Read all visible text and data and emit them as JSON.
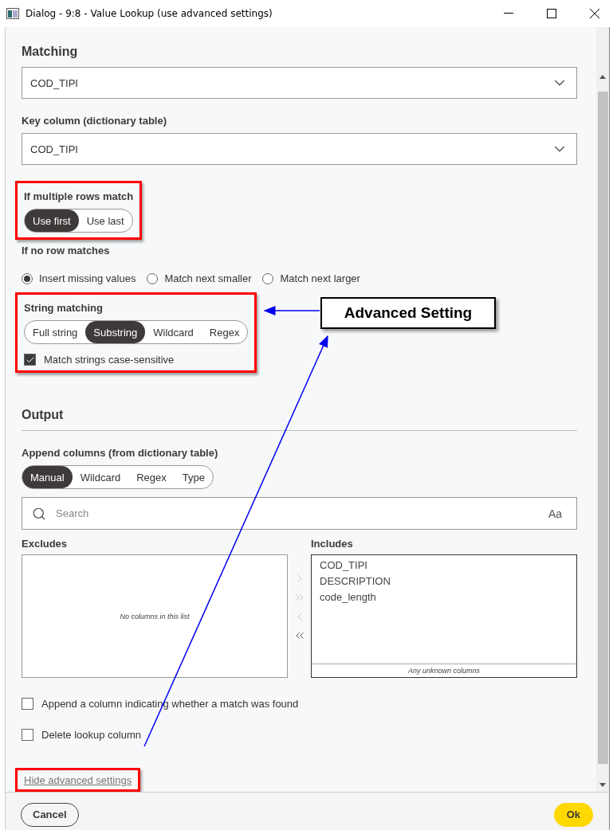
{
  "window": {
    "title": "Dialog - 9:8 - Value Lookup (use advanced settings)"
  },
  "matching": {
    "heading": "Matching",
    "lookup_column": {
      "value": "COD_TIPI"
    },
    "key_column": {
      "label": "Key column (dictionary table)",
      "value": "COD_TIPI"
    }
  },
  "multiple_rows": {
    "label": "If multiple rows match",
    "highlighted": true,
    "options": [
      {
        "label": "Use first",
        "selected": true
      },
      {
        "label": "Use last",
        "selected": false
      }
    ]
  },
  "no_row": {
    "label": "If no row matches",
    "options": [
      {
        "label": "Insert missing values",
        "selected": true
      },
      {
        "label": "Match next smaller",
        "selected": false
      },
      {
        "label": "Match next larger",
        "selected": false
      }
    ]
  },
  "string_matching": {
    "label": "String matching",
    "highlighted": true,
    "options": [
      {
        "label": "Full string",
        "selected": false
      },
      {
        "label": "Substring",
        "selected": true
      },
      {
        "label": "Wildcard",
        "selected": false
      },
      {
        "label": "Regex",
        "selected": false
      }
    ],
    "case_sensitive": {
      "label": "Match strings case-sensitive",
      "checked": true
    }
  },
  "output": {
    "heading": "Output",
    "append_label": "Append columns (from dictionary table)",
    "modes": [
      {
        "label": "Manual",
        "selected": true
      },
      {
        "label": "Wildcard",
        "selected": false
      },
      {
        "label": "Regex",
        "selected": false
      },
      {
        "label": "Type",
        "selected": false
      }
    ],
    "search": {
      "placeholder": "Search",
      "case_toggle": "Aa"
    },
    "excludes": {
      "label": "Excludes",
      "empty_text": "No columns in this list"
    },
    "transfer_buttons": [
      {
        "kind": "add",
        "disabled": true
      },
      {
        "kind": "add_all",
        "disabled": true
      },
      {
        "kind": "remove",
        "disabled": true
      },
      {
        "kind": "remove_all",
        "disabled": false
      }
    ],
    "includes": {
      "label": "Includes",
      "items": [
        "COD_TIPI",
        "DESCRIPTION",
        "code_length"
      ],
      "footer": "Any unknown columns"
    }
  },
  "options": [
    {
      "label": "Append a column indicating whether a match was found",
      "checked": false
    },
    {
      "label": "Delete lookup column",
      "checked": false
    }
  ],
  "advanced_link": {
    "label": "Hide advanced settings",
    "highlighted": true
  },
  "buttons": [
    {
      "label": "Cancel",
      "kind": "secondary"
    },
    {
      "label": "Ok",
      "kind": "primary"
    }
  ],
  "annotation": {
    "text": "Advanced Setting"
  }
}
